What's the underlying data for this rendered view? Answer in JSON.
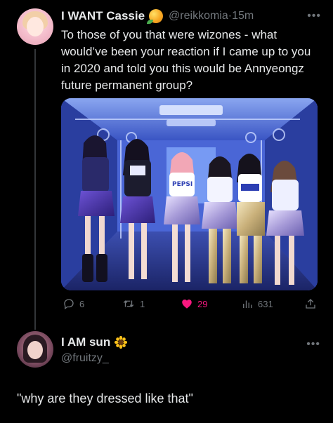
{
  "post": {
    "display_name": "I WANT Cassie",
    "name_emoji": "mango-emoji",
    "handle": "@reikkomia",
    "separator": "·",
    "time": "15m",
    "text": "To those of you that were wizones - what would’ve been your reaction if I came up to you in 2020 and told you this would be Annyeongz future permanent group?",
    "media_sign_text": "PEPSI",
    "actions": {
      "replies": "6",
      "reposts": "1",
      "likes": "29",
      "views": "631"
    },
    "liked": true,
    "like_color": "#f91880"
  },
  "reply": {
    "display_name": "I AM sun",
    "name_emoji": "sunflower-emoji",
    "handle": "@fruitzy_",
    "text": "\"why are they dressed like that\""
  },
  "colors": {
    "background": "#000000",
    "text": "#e7e9ea",
    "muted": "#71767b",
    "accent_like": "#f91880"
  }
}
